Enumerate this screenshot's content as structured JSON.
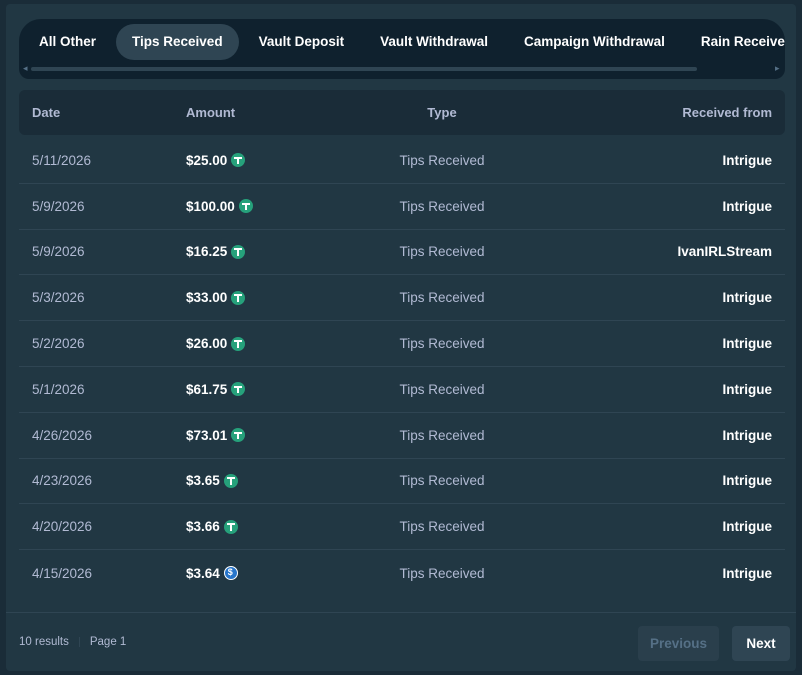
{
  "tabs": [
    "All Other",
    "Tips Received",
    "Vault Deposit",
    "Vault Withdrawal",
    "Campaign Withdrawal",
    "Rain Received"
  ],
  "active_tab": 1,
  "table": {
    "headers": {
      "date": "Date",
      "amount": "Amount",
      "type": "Type",
      "from": "Received from"
    },
    "rows": [
      {
        "date": "5/11/2026",
        "amount": "$25.00",
        "coin": "tether-icon",
        "type": "Tips Received",
        "from": "Intrigue"
      },
      {
        "date": "5/9/2026",
        "amount": "$100.00",
        "coin": "tether-icon",
        "type": "Tips Received",
        "from": "Intrigue"
      },
      {
        "date": "5/9/2026",
        "amount": "$16.25",
        "coin": "tether-icon",
        "type": "Tips Received",
        "from": "IvanIRLStream"
      },
      {
        "date": "5/3/2026",
        "amount": "$33.00",
        "coin": "tether-icon",
        "type": "Tips Received",
        "from": "Intrigue"
      },
      {
        "date": "5/2/2026",
        "amount": "$26.00",
        "coin": "tether-icon",
        "type": "Tips Received",
        "from": "Intrigue"
      },
      {
        "date": "5/1/2026",
        "amount": "$61.75",
        "coin": "tether-icon",
        "type": "Tips Received",
        "from": "Intrigue"
      },
      {
        "date": "4/26/2026",
        "amount": "$73.01",
        "coin": "tether-icon",
        "type": "Tips Received",
        "from": "Intrigue"
      },
      {
        "date": "4/23/2026",
        "amount": "$3.65",
        "coin": "tether-icon",
        "type": "Tips Received",
        "from": "Intrigue"
      },
      {
        "date": "4/20/2026",
        "amount": "$3.66",
        "coin": "tether-icon",
        "type": "Tips Received",
        "from": "Intrigue"
      },
      {
        "date": "4/15/2026",
        "amount": "$3.64",
        "coin": "usdc-icon",
        "type": "Tips Received",
        "from": "Intrigue"
      }
    ]
  },
  "footer": {
    "results": "10 results",
    "page": "Page 1",
    "prev_label": "Previous",
    "next_label": "Next"
  },
  "colors": {
    "background": "#1a2c38",
    "panel": "#213743",
    "tether": "#26a17b",
    "usdc": "#2775ca"
  }
}
